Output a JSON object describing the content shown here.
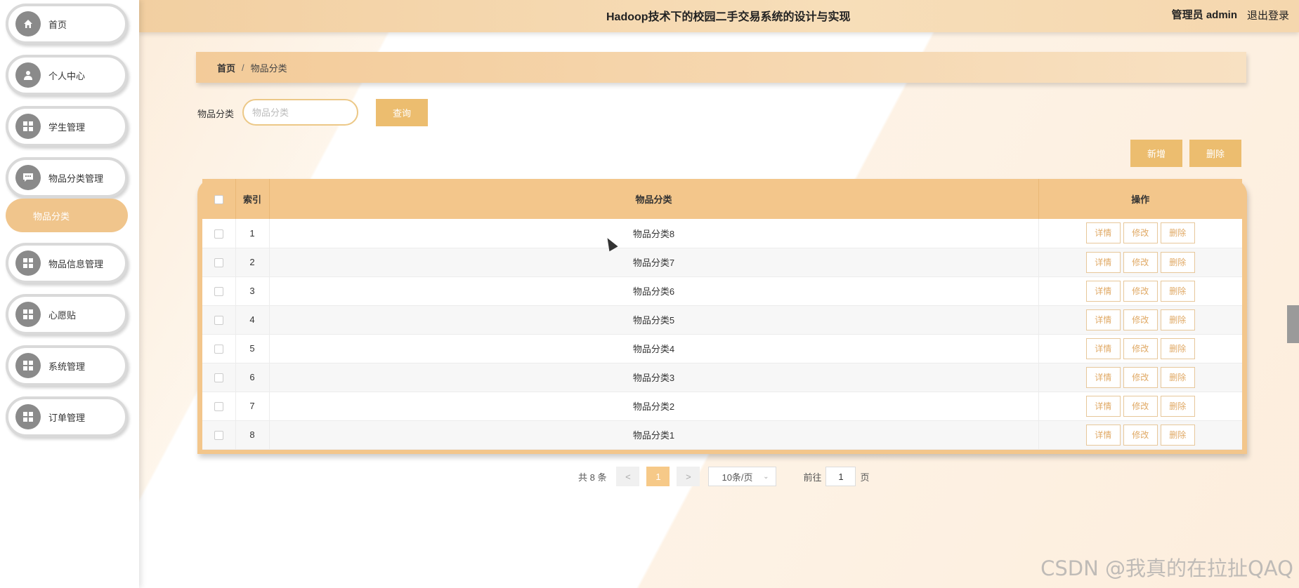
{
  "header": {
    "title": "Hadoop技术下的校园二手交易系统的设计与实现",
    "user": "管理员 admin",
    "logout": "退出登录"
  },
  "sidebar": {
    "items": [
      {
        "label": "首页",
        "icon": "home-icon"
      },
      {
        "label": "个人中心",
        "icon": "user-icon"
      },
      {
        "label": "学生管理",
        "icon": "grid-icon"
      },
      {
        "label": "物品分类管理",
        "icon": "chat-icon"
      },
      {
        "label": "物品信息管理",
        "icon": "grid-icon"
      },
      {
        "label": "心愿贴",
        "icon": "grid-icon"
      },
      {
        "label": "系统管理",
        "icon": "grid-icon"
      },
      {
        "label": "订单管理",
        "icon": "grid-icon"
      }
    ],
    "submenu": {
      "label": "物品分类"
    }
  },
  "breadcrumb": {
    "home": "首页",
    "separator": "/",
    "current": "物品分类"
  },
  "search": {
    "label": "物品分类",
    "placeholder": "物品分类",
    "button": "查询"
  },
  "actions": {
    "add": "新增",
    "delete": "删除"
  },
  "table": {
    "headers": [
      "索引",
      "物品分类",
      "操作"
    ],
    "rows": [
      {
        "index": "1",
        "name": "物品分类8"
      },
      {
        "index": "2",
        "name": "物品分类7"
      },
      {
        "index": "3",
        "name": "物品分类6"
      },
      {
        "index": "4",
        "name": "物品分类5"
      },
      {
        "index": "5",
        "name": "物品分类4"
      },
      {
        "index": "6",
        "name": "物品分类3"
      },
      {
        "index": "7",
        "name": "物品分类2"
      },
      {
        "index": "8",
        "name": "物品分类1"
      }
    ],
    "ops": {
      "detail": "详情",
      "edit": "修改",
      "delete": "删除"
    }
  },
  "pagination": {
    "total": "共 8 条",
    "prev": "<",
    "page": "1",
    "next": ">",
    "page_size": "10条/页",
    "goto_label": "前往",
    "goto_value": "1",
    "page_suffix": "页"
  },
  "watermark": "CSDN @我真的在拉扯QAQ",
  "colors": {
    "accent": "#ecbd6f",
    "header": "#f2cfa1",
    "submenu": "#f0c58c"
  }
}
